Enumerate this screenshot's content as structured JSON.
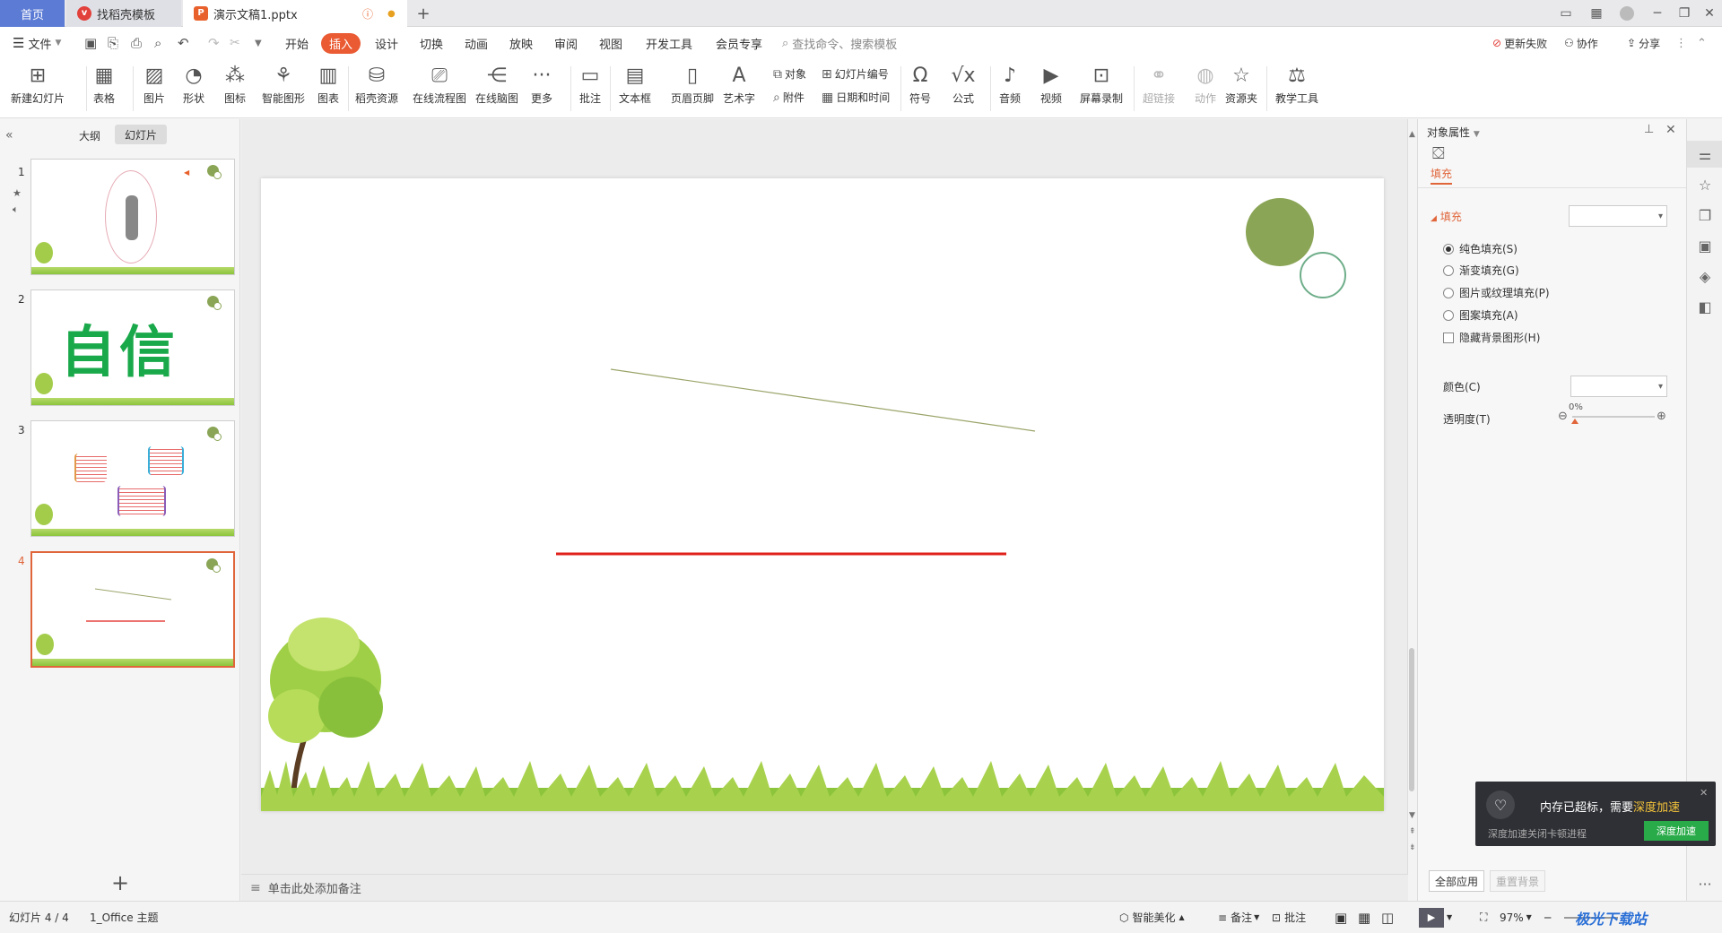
{
  "tabs": {
    "home": "首页",
    "template": "找稻壳模板",
    "doc": "演示文稿1.pptx"
  },
  "menu": {
    "file": "文件",
    "items": [
      "开始",
      "插入",
      "设计",
      "切换",
      "动画",
      "放映",
      "审阅",
      "视图",
      "开发工具",
      "会员专享"
    ],
    "search_placeholder": "查找命令、搜索模板",
    "update_failed": "更新失败",
    "collab": "协作",
    "share": "分享"
  },
  "ribbon": {
    "new_slide": "新建幻灯片",
    "table": "表格",
    "picture": "图片",
    "shape": "形状",
    "icon": "图标",
    "smart_graphic": "智能图形",
    "chart": "图表",
    "docer_res": "稻壳资源",
    "online_flow": "在线流程图",
    "online_mind": "在线脑图",
    "more": "更多",
    "comment": "批注",
    "textbox": "文本框",
    "header_footer": "页眉页脚",
    "art_text": "艺术字",
    "object": "对象",
    "attachment": "附件",
    "slide_number": "幻灯片编号",
    "datetime": "日期和时间",
    "symbol": "符号",
    "formula": "公式",
    "audio": "音频",
    "video": "视频",
    "screen_rec": "屏幕录制",
    "hyperlink": "超链接",
    "action": "动作",
    "resource": "资源夹",
    "teach": "教学工具"
  },
  "left_panel": {
    "outline": "大纲",
    "slides_tab": "幻灯片",
    "thumbs": [
      {
        "num": "1"
      },
      {
        "num": "2",
        "text": "自信"
      },
      {
        "num": "3"
      },
      {
        "num": "4"
      }
    ]
  },
  "notes": {
    "placeholder": "单击此处添加备注"
  },
  "right_panel": {
    "title": "对象属性",
    "fill_tab": "填充",
    "section": "填充",
    "options": [
      "纯色填充(S)",
      "渐变填充(G)",
      "图片或纹理填充(P)",
      "图案填充(A)"
    ],
    "hide_bg": "隐藏背景图形(H)",
    "color_label": "颜色(C)",
    "transparency_label": "透明度(T)",
    "transparency_value": "0%",
    "apply_all": "全部应用",
    "reset_bg": "重置背景"
  },
  "toast": {
    "msg_prefix": "内存已超标，需要",
    "msg_link": "深度加速",
    "sub": "深度加速关闭卡顿进程",
    "button": "深度加速"
  },
  "status": {
    "slide_info": "幻灯片 4 / 4",
    "theme": "1_Office 主题",
    "beautify": "智能美化",
    "notes": "备注",
    "comment": "批注",
    "zoom": "97%",
    "watermark": "极光下载站"
  },
  "colors": {
    "accent": "#ea5a33",
    "home_tab": "#5b7bd5",
    "circle": "#8aa556",
    "red_line": "#e0201a",
    "olive_line": "#9aa56a"
  }
}
